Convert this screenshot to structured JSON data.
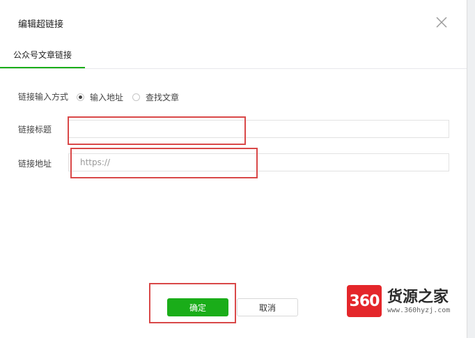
{
  "dialog": {
    "title": "编辑超链接",
    "tab_label": "公众号文章链接"
  },
  "form": {
    "input_method_label": "链接输入方式",
    "options": [
      "输入地址",
      "查找文章"
    ],
    "selected_option": "输入地址",
    "title_label": "链接标题",
    "title_value": "",
    "url_label": "链接地址",
    "url_placeholder": "https://"
  },
  "buttons": {
    "confirm": "确定",
    "cancel": "取消"
  },
  "watermark": {
    "badge": "360",
    "name": "货源之家",
    "url": "www.360hyzj.com"
  },
  "colors": {
    "primary": "#1aad19",
    "highlight_box": "#d94848"
  }
}
